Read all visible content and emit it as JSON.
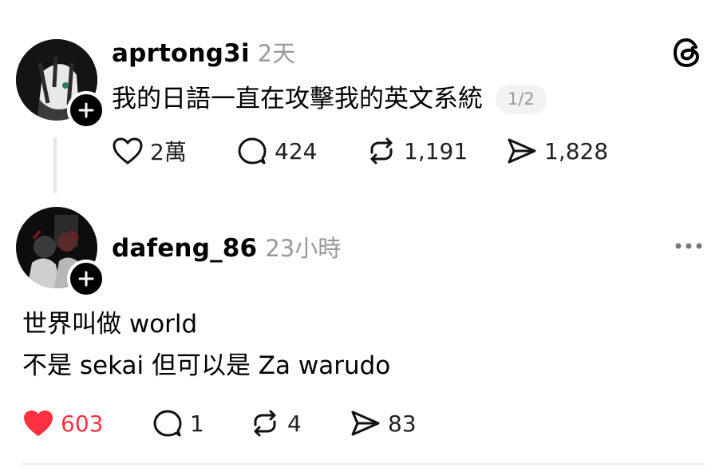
{
  "post1": {
    "username": "aprtong3i",
    "time": "2天",
    "text": "我的日語一直在攻擊我的英文系統",
    "page_badge": "1/2",
    "likes": "2萬",
    "replies": "424",
    "reposts": "1,191",
    "shares": "1,828",
    "avatar_icon": "profile-avatar",
    "header_icon": "threads-logo-icon"
  },
  "post2": {
    "username": "dafeng_86",
    "time": "23小時",
    "text_lines": [
      "世界叫做 world",
      "不是 sekai 但可以是 Za warudo"
    ],
    "likes": "603",
    "replies": "1",
    "reposts": "4",
    "shares": "83",
    "liked": true,
    "like_color": "#ff3040",
    "more_icon": "more-icon"
  }
}
